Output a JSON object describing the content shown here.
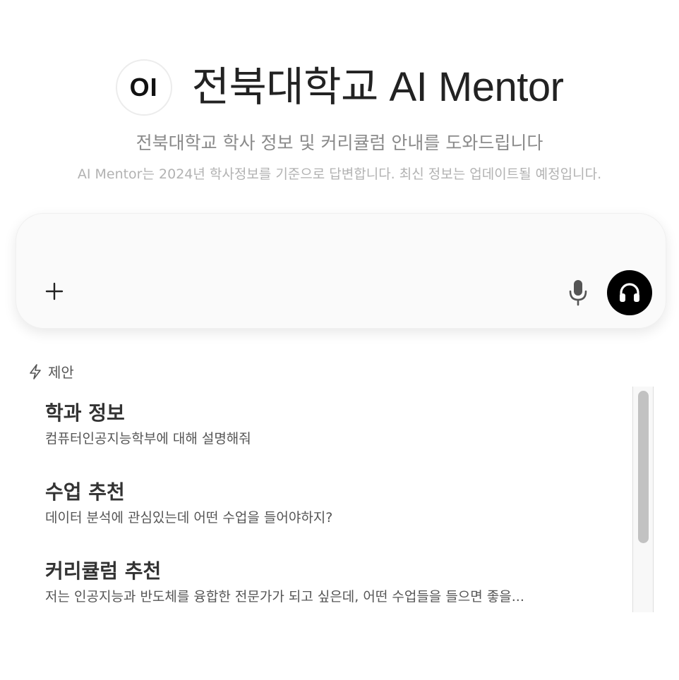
{
  "header": {
    "logo_text": "OI",
    "title": "전북대학교 AI Mentor"
  },
  "subtitle": "전북대학교 학사 정보 및 커리큘럼 안내를 도와드립니다",
  "notice": "AI Mentor는 2024년 학사정보를 기준으로 답변합니다. 최신 정보는 업데이트될 예정입니다.",
  "chat": {
    "input_value": "",
    "attach_icon": "plus-icon",
    "voice_icon": "microphone-icon",
    "call_icon": "headphones-icon"
  },
  "suggestions": {
    "heading": "제안",
    "heading_icon": "lightning-bolt-icon",
    "items": [
      {
        "title": "학과 정보",
        "description": "컴퓨터인공지능학부에 대해 설명해줘"
      },
      {
        "title": "수업 추천",
        "description": "데이터 분석에 관심있는데 어떤 수업을 들어야하지?"
      },
      {
        "title": "커리큘럼 추천",
        "description": "저는 인공지능과 반도체를 융합한 전문가가 되고 싶은데, 어떤 수업들을 들으면 좋을..."
      }
    ]
  },
  "colors": {
    "accent": "#000000",
    "text_primary": "#222222",
    "text_muted": "#8a8a8a"
  }
}
